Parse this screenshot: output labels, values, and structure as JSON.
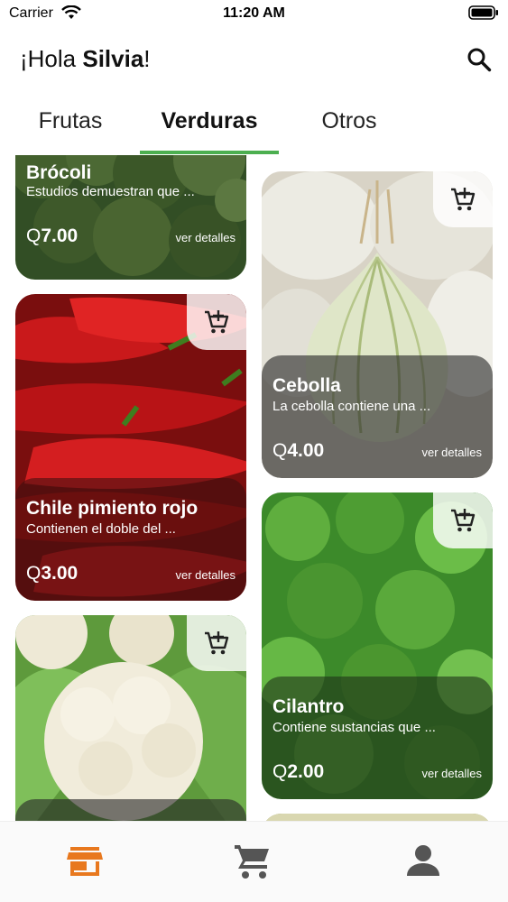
{
  "status_bar": {
    "carrier": "Carrier",
    "time": "11:20 AM"
  },
  "header": {
    "greeting_prefix": "¡Hola ",
    "user_name": "Silvia",
    "greeting_suffix": "!"
  },
  "tabs": [
    {
      "label": "Frutas",
      "active": false
    },
    {
      "label": "Verduras",
      "active": true
    },
    {
      "label": "Otros",
      "active": false
    }
  ],
  "products": [
    {
      "name": "Brócoli",
      "description": "Estudios demuestran que ...",
      "price": "7.00",
      "currency": "Q",
      "details_label": "ver detalles"
    },
    {
      "name": "Cebolla",
      "description": "La cebolla contiene una ...",
      "price": "4.00",
      "currency": "Q",
      "details_label": "ver detalles"
    },
    {
      "name": "Chile pimiento rojo",
      "description": "Contienen el doble del ...",
      "price": "3.00",
      "currency": "Q",
      "details_label": "ver detalles"
    },
    {
      "name": "Cilantro",
      "description": "Contiene sustancias que ...",
      "price": "2.00",
      "currency": "Q",
      "details_label": "ver detalles"
    },
    {
      "name": "",
      "description": "",
      "price": "",
      "currency": "",
      "details_label": ""
    }
  ],
  "icons": {
    "wifi": "wifi-icon",
    "battery": "battery-icon",
    "search": "search-icon",
    "add_to_cart": "add-to-cart-icon",
    "store": "store-icon",
    "cart": "cart-icon",
    "profile": "person-icon"
  },
  "colors": {
    "accent_green": "#4caf50",
    "nav_active": "#e8781e",
    "nav_inactive": "#555555",
    "card_overlay": "rgba(40,40,40,0.62)"
  }
}
